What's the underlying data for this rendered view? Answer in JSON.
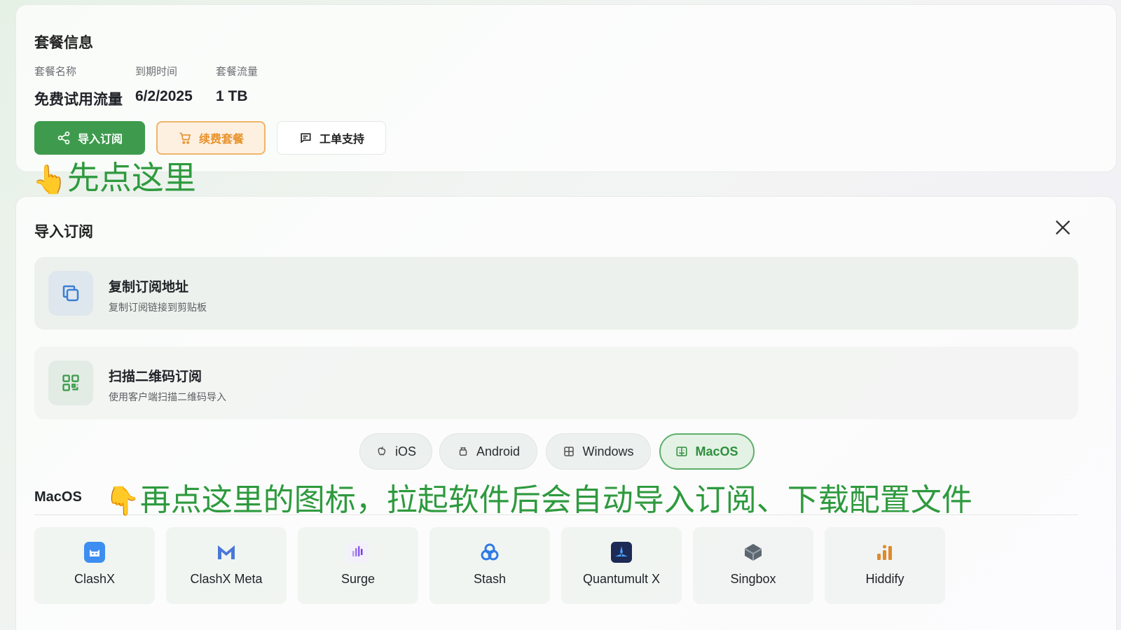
{
  "plan": {
    "title": "套餐信息",
    "fields": [
      {
        "label": "套餐名称",
        "value": "免费试用流量"
      },
      {
        "label": "到期时间",
        "value": "6/2/2025"
      },
      {
        "label": "套餐流量",
        "value": "1 TB"
      }
    ],
    "buttons": {
      "import": "导入订阅",
      "renew": "续费套餐",
      "ticket": "工单支持"
    }
  },
  "annotations": {
    "first": {
      "emoji": "👆",
      "text": "先点这里"
    },
    "second": {
      "emoji": "👇",
      "text": "再点这里的图标，拉起软件后会自动导入订阅、下载配置文件"
    }
  },
  "import_panel": {
    "title": "导入订阅",
    "options": [
      {
        "title": "复制订阅地址",
        "subtitle": "复制订阅链接到剪贴板",
        "icon": "copy-icon"
      },
      {
        "title": "扫描二维码订阅",
        "subtitle": "使用客户端扫描二维码导入",
        "icon": "qr-code-icon"
      }
    ],
    "tabs": [
      {
        "label": "iOS",
        "icon": "apple-icon"
      },
      {
        "label": "Android",
        "icon": "android-icon"
      },
      {
        "label": "Windows",
        "icon": "windows-icon"
      },
      {
        "label": "MacOS",
        "icon": "finder-icon",
        "active": true
      }
    ],
    "section_label": "MacOS",
    "apps": [
      {
        "name": "ClashX",
        "icon": "clashx-icon",
        "color": "#3d8ef0"
      },
      {
        "name": "ClashX Meta",
        "icon": "clashx-meta-icon",
        "color": "#4a78d8"
      },
      {
        "name": "Surge",
        "icon": "surge-icon",
        "color": "#8a5cf0"
      },
      {
        "name": "Stash",
        "icon": "stash-icon",
        "color": "#2f7ae5"
      },
      {
        "name": "Quantumult X",
        "icon": "quantumult-x-icon",
        "color": "#1c2a55"
      },
      {
        "name": "Singbox",
        "icon": "singbox-icon",
        "color": "#5c6670"
      },
      {
        "name": "Hiddify",
        "icon": "hiddify-icon",
        "color": "#e0892f"
      }
    ]
  },
  "colors": {
    "primary": "#3e9b4d",
    "renew": "#e8922c",
    "annotation": "#2e9a3e"
  }
}
